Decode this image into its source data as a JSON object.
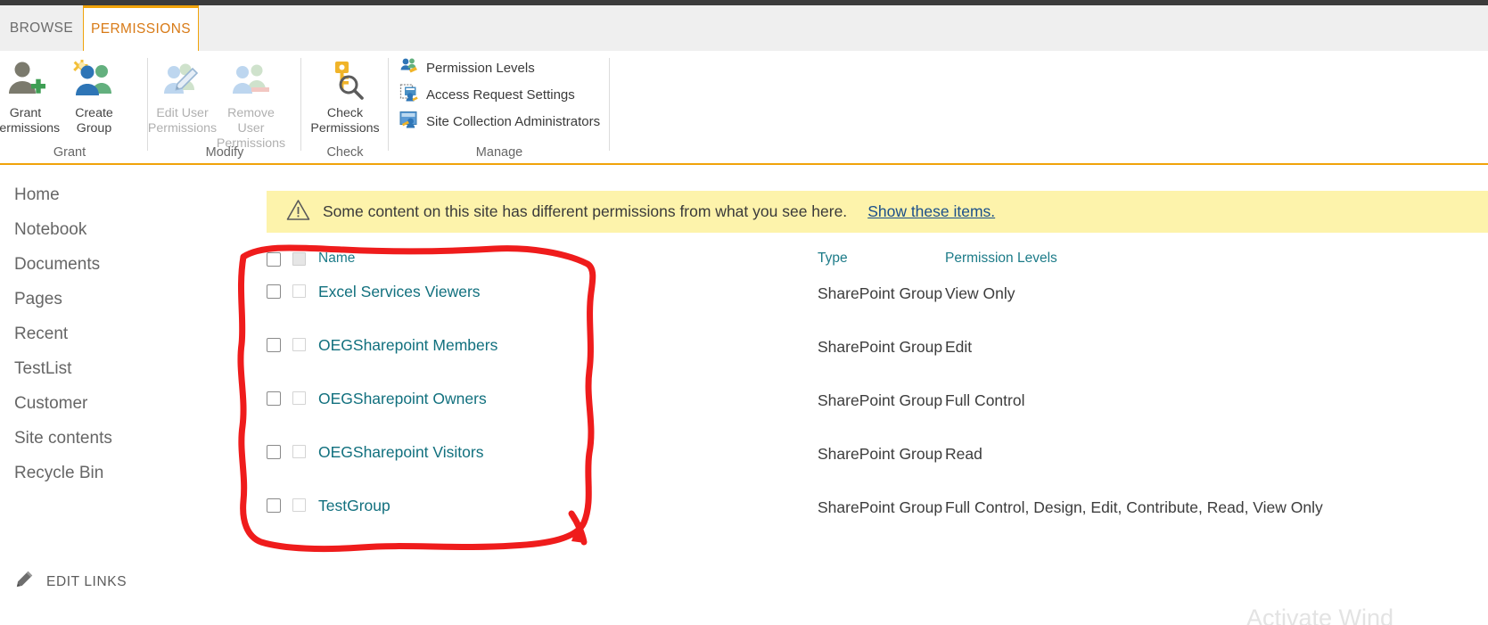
{
  "tabs": [
    {
      "label": "BROWSE",
      "active": false
    },
    {
      "label": "PERMISSIONS",
      "active": true
    }
  ],
  "ribbon": {
    "groups": [
      {
        "name": "Grant",
        "label": "Grant",
        "buttons": [
          {
            "label": "Grant\nPermissions",
            "icon": "person-plus-icon",
            "disabled": false
          },
          {
            "label": "Create\nGroup",
            "icon": "create-group-icon",
            "disabled": false
          }
        ]
      },
      {
        "name": "Modify",
        "label": "Modify",
        "buttons": [
          {
            "label": "Edit User\nPermissions",
            "icon": "edit-user-permissions-icon",
            "disabled": true
          },
          {
            "label": "Remove User\nPermissions",
            "icon": "remove-user-permissions-icon",
            "disabled": true
          }
        ]
      },
      {
        "name": "Check",
        "label": "Check",
        "buttons": [
          {
            "label": "Check\nPermissions",
            "icon": "key-magnifier-icon",
            "disabled": false
          }
        ]
      },
      {
        "name": "Manage",
        "label": "Manage",
        "buttons": [
          {
            "label": "Permission Levels",
            "icon": "permission-levels-icon",
            "disabled": false
          },
          {
            "label": "Access Request Settings",
            "icon": "access-request-settings-icon",
            "disabled": false
          },
          {
            "label": "Site Collection Administrators",
            "icon": "site-collection-administrators-icon",
            "disabled": false
          }
        ]
      }
    ]
  },
  "sidebar": {
    "items": [
      {
        "label": "Home"
      },
      {
        "label": "Notebook"
      },
      {
        "label": "Documents"
      },
      {
        "label": "Pages"
      },
      {
        "label": "Recent"
      },
      {
        "label": "TestList"
      },
      {
        "label": "Customer"
      },
      {
        "label": "Site contents"
      },
      {
        "label": "Recycle Bin"
      }
    ],
    "edit_links": "EDIT LINKS"
  },
  "notice": {
    "icon": "warning-triangle-icon",
    "text": "Some content on this site has different permissions from what you see here.",
    "link": "Show these items.",
    "background": "#fdf3ab"
  },
  "table": {
    "headers": {
      "name": "Name",
      "type": "Type",
      "permission_levels": "Permission Levels"
    },
    "rows": [
      {
        "name": "Excel Services Viewers",
        "type": "SharePoint Group",
        "permissions": "View Only"
      },
      {
        "name": "OEGSharepoint Members",
        "type": "SharePoint Group",
        "permissions": "Edit"
      },
      {
        "name": "OEGSharepoint Owners",
        "type": "SharePoint Group",
        "permissions": "Full Control"
      },
      {
        "name": "OEGSharepoint Visitors",
        "type": "SharePoint Group",
        "permissions": "Read"
      },
      {
        "name": "TestGroup",
        "type": "SharePoint Group",
        "permissions": "Full Control, Design, Edit, Contribute, Read, View Only"
      }
    ]
  },
  "annotation": {
    "shape": "hand-drawn-red-rectangle-with-arrow",
    "color": "#ef1c1c"
  },
  "watermark": {
    "text": "Activate Wind"
  },
  "colors": {
    "accent": "#f0a30a",
    "tab_active_text": "#d87a16",
    "link": "#11707e",
    "header_link": "#1c7b88",
    "notice_bg": "#fdf3ab"
  }
}
